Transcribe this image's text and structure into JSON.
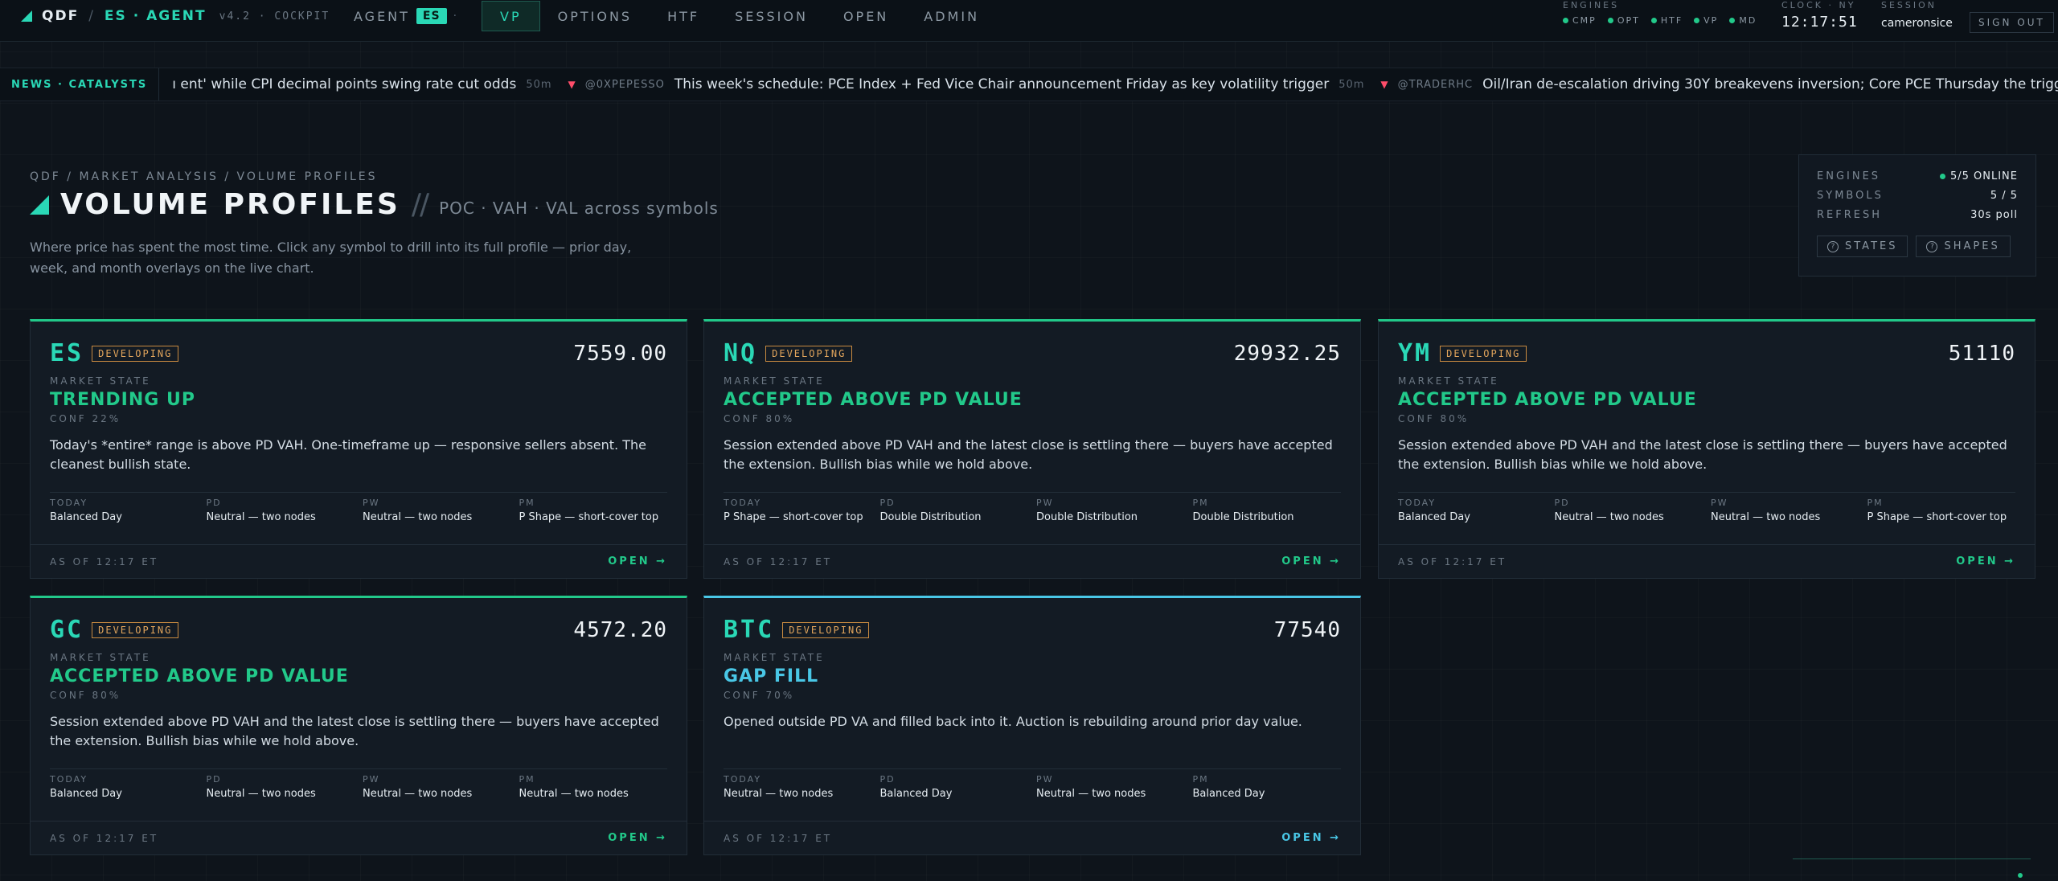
{
  "brand": {
    "name": "QDF",
    "sep": "/",
    "agent": "ES · AGENT",
    "version": "v4.2 · COCKPIT"
  },
  "nav": {
    "agent_label": "AGENT",
    "agent_symbol": "ES",
    "agent_dot": "·",
    "items": [
      "VP",
      "OPTIONS",
      "HTF",
      "SESSION",
      "OPEN",
      "ADMIN"
    ],
    "active": "VP"
  },
  "engines_top": {
    "label": "ENGINES",
    "items": [
      "CMP",
      "OPT",
      "HTF",
      "VP",
      "MD"
    ]
  },
  "clock": {
    "label": "CLOCK · NY",
    "time": "12:17:51"
  },
  "session": {
    "label": "SESSION",
    "user": "cameronsice",
    "signout": "SIGN OUT"
  },
  "ticker": {
    "label": "NEWS · CATALYSTS",
    "items": [
      {
        "user": "",
        "text": "ı ent' while CPI decimal points swing rate cut odds",
        "age": "50m"
      },
      {
        "user": "@0XPEPESSO",
        "text": "This week's schedule: PCE Index + Fed Vice Chair announcement Friday as key volatility trigger",
        "age": "50m"
      },
      {
        "user": "@TRADERHC",
        "text": "Oil/Iran de-escalation driving 30Y breakevens inversion; Core PCE Thursday the trigger for rate-sen",
        "age": ""
      }
    ]
  },
  "header": {
    "breadcrumb": "QDF / MARKET ANALYSIS / VOLUME PROFILES",
    "title": "VOLUME PROFILES",
    "slash": "//",
    "subtitle": "POC · VAH · VAL across symbols",
    "description": "Where price has spent the most time. Click any symbol to drill into its full profile — prior day, week, and month overlays on the live chart."
  },
  "stats": {
    "engines_label": "ENGINES",
    "engines_value": "5/5 ONLINE",
    "symbols_label": "SYMBOLS",
    "symbols_value": "5 / 5",
    "refresh_label": "REFRESH",
    "refresh_value": "30s poll",
    "states_btn": "STATES",
    "shapes_btn": "SHAPES"
  },
  "shape_labels": {
    "today": "TODAY",
    "pd": "PD",
    "pw": "PW",
    "pm": "PM"
  },
  "common": {
    "ms_label": "MARKET STATE",
    "open": "OPEN →"
  },
  "cards": [
    {
      "symbol": "ES",
      "badge": "DEVELOPING",
      "price": "7559.00",
      "state": "TRENDING UP",
      "conf": "CONF 22%",
      "explain": "Today's *entire* range is above PD VAH. One-timeframe up — responsive sellers absent. The cleanest bullish state.",
      "today": "Balanced Day",
      "pd": "Neutral — two nodes",
      "pw": "Neutral — two nodes",
      "pm": "P Shape — short-cover top",
      "asof": "AS OF 12:17 ET",
      "accent": "#22c98a"
    },
    {
      "symbol": "NQ",
      "badge": "DEVELOPING",
      "price": "29932.25",
      "state": "ACCEPTED ABOVE PD VALUE",
      "conf": "CONF 80%",
      "explain": "Session extended above PD VAH and the latest close is settling there — buyers have accepted the extension. Bullish bias while we hold above.",
      "today": "P Shape — short-cover top",
      "pd": "Double Distribution",
      "pw": "Double Distribution",
      "pm": "Double Distribution",
      "asof": "AS OF 12:17 ET",
      "accent": "#22c98a"
    },
    {
      "symbol": "YM",
      "badge": "DEVELOPING",
      "price": "51110",
      "state": "ACCEPTED ABOVE PD VALUE",
      "conf": "CONF 80%",
      "explain": "Session extended above PD VAH and the latest close is settling there — buyers have accepted the extension. Bullish bias while we hold above.",
      "today": "Balanced Day",
      "pd": "Neutral — two nodes",
      "pw": "Neutral — two nodes",
      "pm": "P Shape — short-cover top",
      "asof": "AS OF 12:17 ET",
      "accent": "#22c98a"
    },
    {
      "symbol": "GC",
      "badge": "DEVELOPING",
      "price": "4572.20",
      "state": "ACCEPTED ABOVE PD VALUE",
      "conf": "CONF 80%",
      "explain": "Session extended above PD VAH and the latest close is settling there — buyers have accepted the extension. Bullish bias while we hold above.",
      "today": "Balanced Day",
      "pd": "Neutral — two nodes",
      "pw": "Neutral — two nodes",
      "pm": "Neutral — two nodes",
      "asof": "AS OF 12:17 ET",
      "accent": "#22c98a"
    },
    {
      "symbol": "BTC",
      "badge": "DEVELOPING",
      "price": "77540",
      "state": "GAP FILL",
      "conf": "CONF 70%",
      "explain": "Opened outside PD VA and filled back into it. Auction is rebuilding around prior day value.",
      "today": "Neutral — two nodes",
      "pd": "Balanced Day",
      "pw": "Neutral — two nodes",
      "pm": "Balanced Day",
      "asof": "AS OF 12:17 ET",
      "accent": "#49c7e6"
    }
  ]
}
